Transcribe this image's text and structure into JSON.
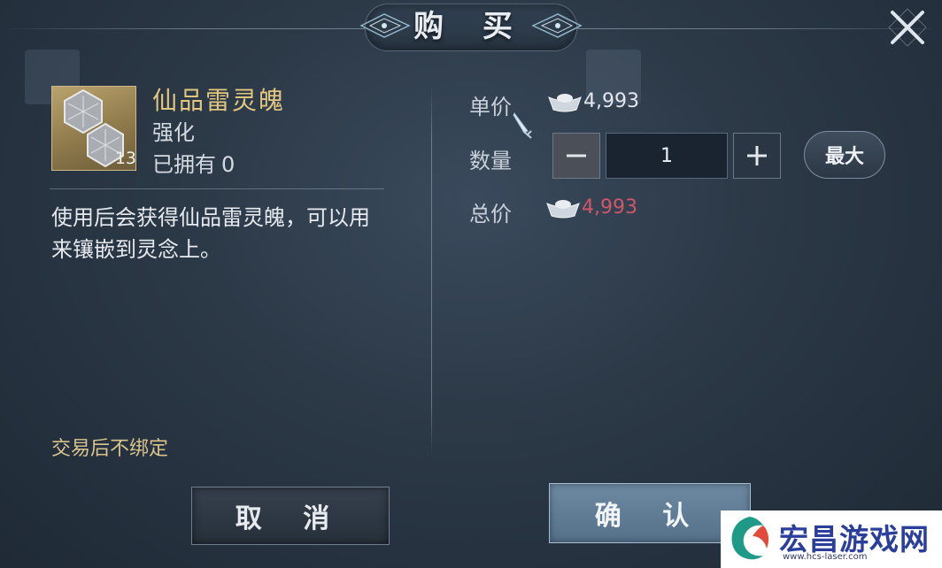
{
  "dialog": {
    "title": "购 买"
  },
  "item": {
    "name": "仙品雷灵魄",
    "type": "强化",
    "owned_label": "已拥有",
    "owned_count": "0",
    "stack_count": "13",
    "description": "使用后会获得仙品雷灵魄，可以用来镶嵌到灵念上。",
    "bind_note": "交易后不绑定"
  },
  "purchase": {
    "unit_price_label": "单价",
    "unit_price": "4,993",
    "quantity_label": "数量",
    "quantity": "1",
    "max_label": "最大",
    "total_label": "总价",
    "total_price": "4,993",
    "currency_icon": "silver-ingot-icon"
  },
  "buttons": {
    "cancel": "取 消",
    "confirm": "确 认"
  },
  "watermark": {
    "text": "宏昌游戏网",
    "url": "www.hcs-laser.com"
  },
  "colors": {
    "item_name": "#e3c77e",
    "total_price": "#d2566a",
    "bind_note": "#d9c48e"
  }
}
